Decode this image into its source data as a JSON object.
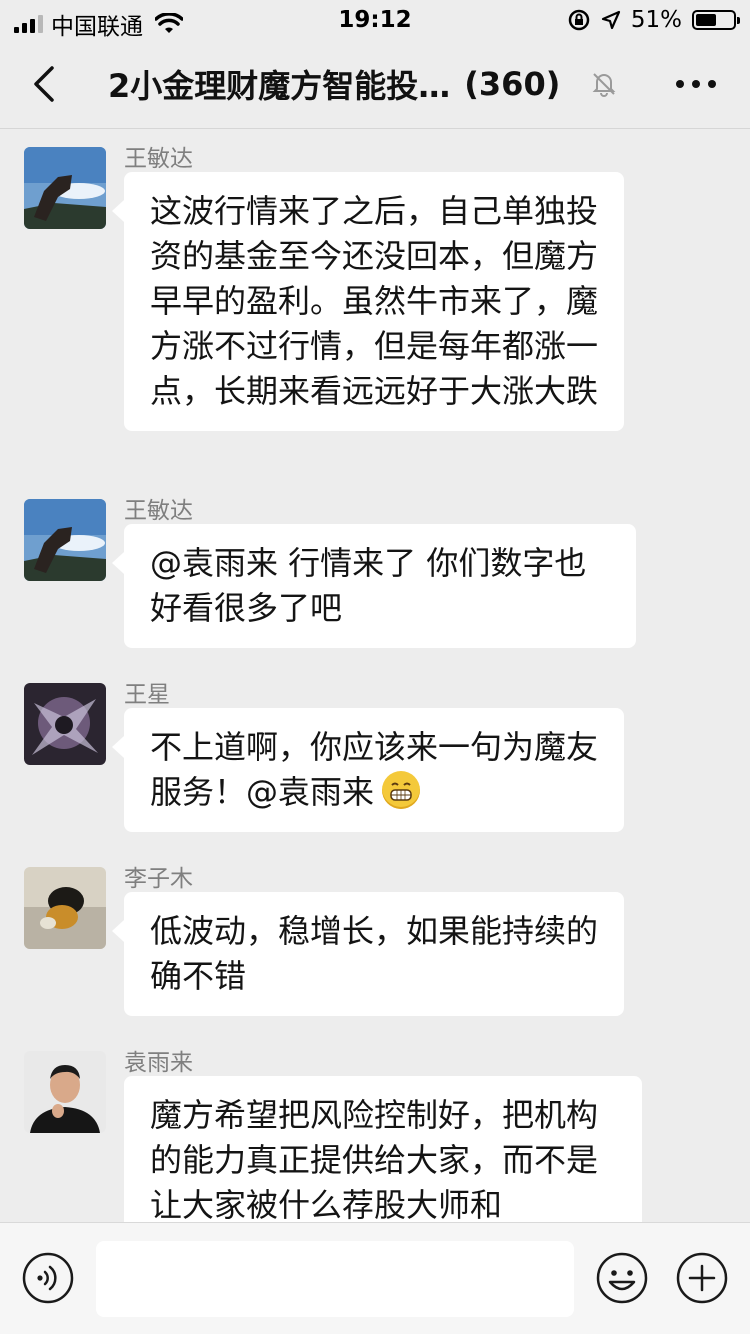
{
  "status_bar": {
    "carrier": "中国联通",
    "time": "19:12",
    "battery_text": "51%",
    "battery_level": 0.51
  },
  "nav": {
    "title": "2小金理财魔方智能投…",
    "member_count": "(360)"
  },
  "messages": [
    {
      "sender": "王敏达",
      "text": "这波行情来了之后，自己单独投资的基金至今还没回本，但魔方早早的盈利。虽然牛市来了，魔方涨不过行情，但是每年都涨一点，长期来看远远好于大涨大跌"
    },
    {
      "sender": "王敏达",
      "text": "@袁雨来 行情来了 你们数字也好看很多了吧"
    },
    {
      "sender": "王星",
      "text": "不上道啊，你应该来一句为魔友服务！@袁雨来",
      "emoji": "grin-emoji"
    },
    {
      "sender": "李子木",
      "text": "低波动，稳增长，如果能持续的确不错"
    },
    {
      "sender": "袁雨来",
      "text": "魔方希望把风险控制好，把机构的能力真正提供给大家，而不是让大家被什么荐股大师和"
    }
  ],
  "input_bar": {
    "placeholder": ""
  },
  "colors": {
    "background": "#ededed",
    "bubble": "#ffffff",
    "sender_name": "#7f7f7f"
  }
}
